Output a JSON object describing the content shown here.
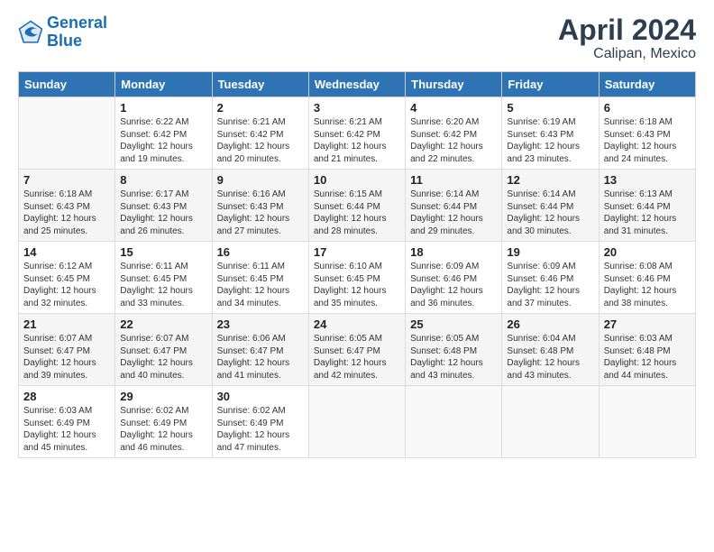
{
  "header": {
    "logo_line1": "General",
    "logo_line2": "Blue",
    "title": "April 2024",
    "subtitle": "Calipan, Mexico"
  },
  "calendar": {
    "weekdays": [
      "Sunday",
      "Monday",
      "Tuesday",
      "Wednesday",
      "Thursday",
      "Friday",
      "Saturday"
    ],
    "weeks": [
      [
        {
          "day": "",
          "sunrise": "",
          "sunset": "",
          "daylight": ""
        },
        {
          "day": "1",
          "sunrise": "Sunrise: 6:22 AM",
          "sunset": "Sunset: 6:42 PM",
          "daylight": "Daylight: 12 hours and 19 minutes."
        },
        {
          "day": "2",
          "sunrise": "Sunrise: 6:21 AM",
          "sunset": "Sunset: 6:42 PM",
          "daylight": "Daylight: 12 hours and 20 minutes."
        },
        {
          "day": "3",
          "sunrise": "Sunrise: 6:21 AM",
          "sunset": "Sunset: 6:42 PM",
          "daylight": "Daylight: 12 hours and 21 minutes."
        },
        {
          "day": "4",
          "sunrise": "Sunrise: 6:20 AM",
          "sunset": "Sunset: 6:42 PM",
          "daylight": "Daylight: 12 hours and 22 minutes."
        },
        {
          "day": "5",
          "sunrise": "Sunrise: 6:19 AM",
          "sunset": "Sunset: 6:43 PM",
          "daylight": "Daylight: 12 hours and 23 minutes."
        },
        {
          "day": "6",
          "sunrise": "Sunrise: 6:18 AM",
          "sunset": "Sunset: 6:43 PM",
          "daylight": "Daylight: 12 hours and 24 minutes."
        }
      ],
      [
        {
          "day": "7",
          "sunrise": "Sunrise: 6:18 AM",
          "sunset": "Sunset: 6:43 PM",
          "daylight": "Daylight: 12 hours and 25 minutes."
        },
        {
          "day": "8",
          "sunrise": "Sunrise: 6:17 AM",
          "sunset": "Sunset: 6:43 PM",
          "daylight": "Daylight: 12 hours and 26 minutes."
        },
        {
          "day": "9",
          "sunrise": "Sunrise: 6:16 AM",
          "sunset": "Sunset: 6:43 PM",
          "daylight": "Daylight: 12 hours and 27 minutes."
        },
        {
          "day": "10",
          "sunrise": "Sunrise: 6:15 AM",
          "sunset": "Sunset: 6:44 PM",
          "daylight": "Daylight: 12 hours and 28 minutes."
        },
        {
          "day": "11",
          "sunrise": "Sunrise: 6:14 AM",
          "sunset": "Sunset: 6:44 PM",
          "daylight": "Daylight: 12 hours and 29 minutes."
        },
        {
          "day": "12",
          "sunrise": "Sunrise: 6:14 AM",
          "sunset": "Sunset: 6:44 PM",
          "daylight": "Daylight: 12 hours and 30 minutes."
        },
        {
          "day": "13",
          "sunrise": "Sunrise: 6:13 AM",
          "sunset": "Sunset: 6:44 PM",
          "daylight": "Daylight: 12 hours and 31 minutes."
        }
      ],
      [
        {
          "day": "14",
          "sunrise": "Sunrise: 6:12 AM",
          "sunset": "Sunset: 6:45 PM",
          "daylight": "Daylight: 12 hours and 32 minutes."
        },
        {
          "day": "15",
          "sunrise": "Sunrise: 6:11 AM",
          "sunset": "Sunset: 6:45 PM",
          "daylight": "Daylight: 12 hours and 33 minutes."
        },
        {
          "day": "16",
          "sunrise": "Sunrise: 6:11 AM",
          "sunset": "Sunset: 6:45 PM",
          "daylight": "Daylight: 12 hours and 34 minutes."
        },
        {
          "day": "17",
          "sunrise": "Sunrise: 6:10 AM",
          "sunset": "Sunset: 6:45 PM",
          "daylight": "Daylight: 12 hours and 35 minutes."
        },
        {
          "day": "18",
          "sunrise": "Sunrise: 6:09 AM",
          "sunset": "Sunset: 6:46 PM",
          "daylight": "Daylight: 12 hours and 36 minutes."
        },
        {
          "day": "19",
          "sunrise": "Sunrise: 6:09 AM",
          "sunset": "Sunset: 6:46 PM",
          "daylight": "Daylight: 12 hours and 37 minutes."
        },
        {
          "day": "20",
          "sunrise": "Sunrise: 6:08 AM",
          "sunset": "Sunset: 6:46 PM",
          "daylight": "Daylight: 12 hours and 38 minutes."
        }
      ],
      [
        {
          "day": "21",
          "sunrise": "Sunrise: 6:07 AM",
          "sunset": "Sunset: 6:47 PM",
          "daylight": "Daylight: 12 hours and 39 minutes."
        },
        {
          "day": "22",
          "sunrise": "Sunrise: 6:07 AM",
          "sunset": "Sunset: 6:47 PM",
          "daylight": "Daylight: 12 hours and 40 minutes."
        },
        {
          "day": "23",
          "sunrise": "Sunrise: 6:06 AM",
          "sunset": "Sunset: 6:47 PM",
          "daylight": "Daylight: 12 hours and 41 minutes."
        },
        {
          "day": "24",
          "sunrise": "Sunrise: 6:05 AM",
          "sunset": "Sunset: 6:47 PM",
          "daylight": "Daylight: 12 hours and 42 minutes."
        },
        {
          "day": "25",
          "sunrise": "Sunrise: 6:05 AM",
          "sunset": "Sunset: 6:48 PM",
          "daylight": "Daylight: 12 hours and 43 minutes."
        },
        {
          "day": "26",
          "sunrise": "Sunrise: 6:04 AM",
          "sunset": "Sunset: 6:48 PM",
          "daylight": "Daylight: 12 hours and 43 minutes."
        },
        {
          "day": "27",
          "sunrise": "Sunrise: 6:03 AM",
          "sunset": "Sunset: 6:48 PM",
          "daylight": "Daylight: 12 hours and 44 minutes."
        }
      ],
      [
        {
          "day": "28",
          "sunrise": "Sunrise: 6:03 AM",
          "sunset": "Sunset: 6:49 PM",
          "daylight": "Daylight: 12 hours and 45 minutes."
        },
        {
          "day": "29",
          "sunrise": "Sunrise: 6:02 AM",
          "sunset": "Sunset: 6:49 PM",
          "daylight": "Daylight: 12 hours and 46 minutes."
        },
        {
          "day": "30",
          "sunrise": "Sunrise: 6:02 AM",
          "sunset": "Sunset: 6:49 PM",
          "daylight": "Daylight: 12 hours and 47 minutes."
        },
        {
          "day": "",
          "sunrise": "",
          "sunset": "",
          "daylight": ""
        },
        {
          "day": "",
          "sunrise": "",
          "sunset": "",
          "daylight": ""
        },
        {
          "day": "",
          "sunrise": "",
          "sunset": "",
          "daylight": ""
        },
        {
          "day": "",
          "sunrise": "",
          "sunset": "",
          "daylight": ""
        }
      ]
    ]
  }
}
